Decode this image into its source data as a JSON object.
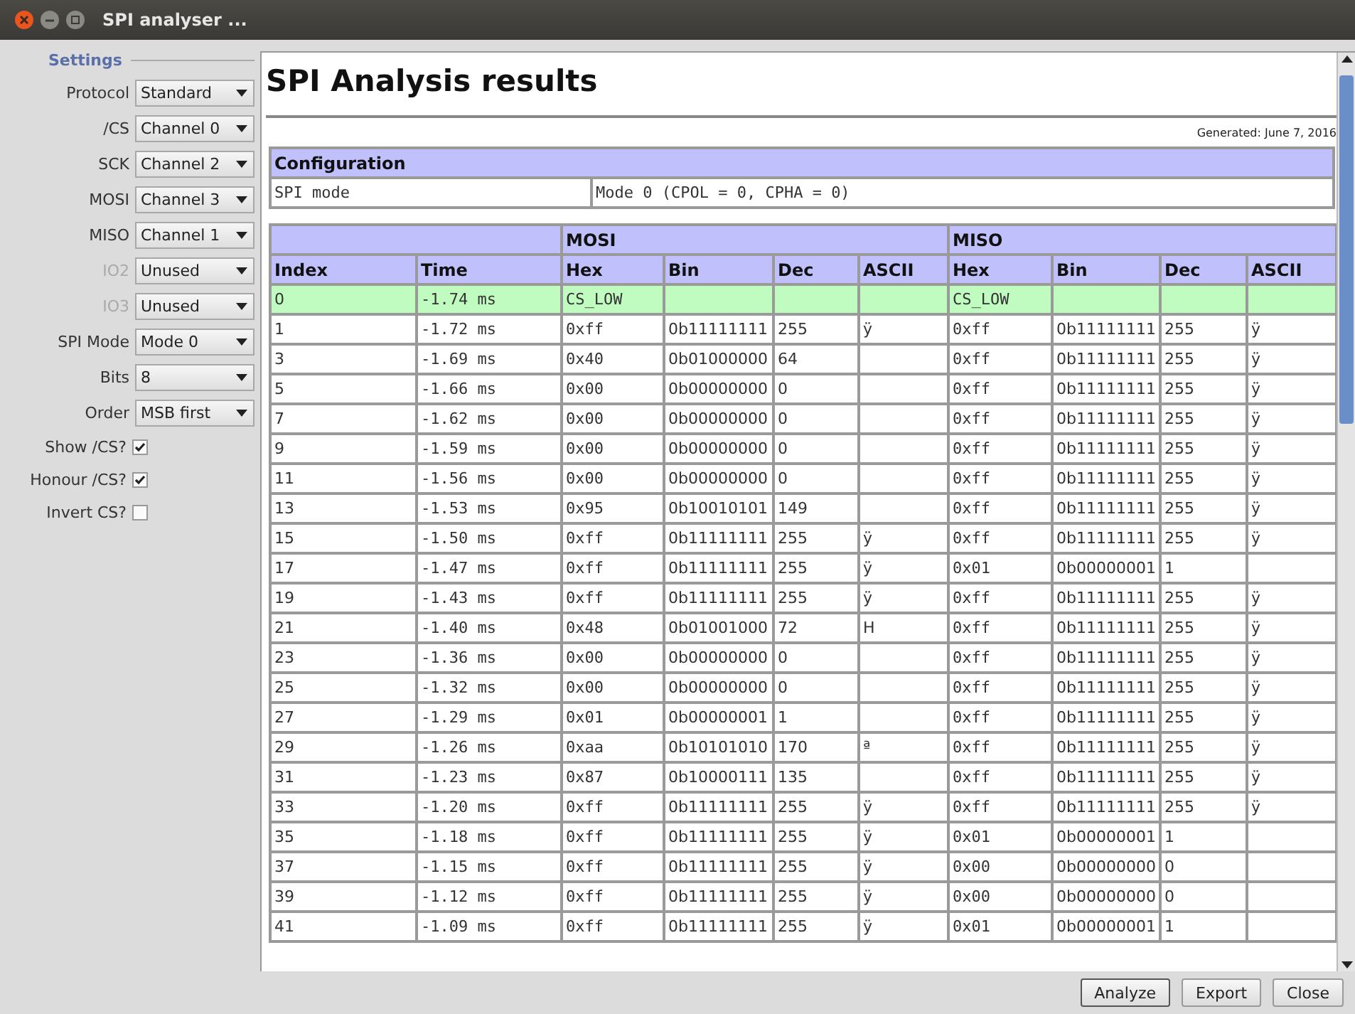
{
  "window": {
    "title": "SPI analyser ..."
  },
  "settings": {
    "title": "Settings",
    "items": [
      {
        "kind": "select",
        "label": "Protocol",
        "value": "Standard",
        "disabled": false
      },
      {
        "kind": "select",
        "label": "/CS",
        "value": "Channel 0",
        "disabled": false
      },
      {
        "kind": "select",
        "label": "SCK",
        "value": "Channel 2",
        "disabled": false
      },
      {
        "kind": "select",
        "label": "MOSI",
        "value": "Channel 3",
        "disabled": false
      },
      {
        "kind": "select",
        "label": "MISO",
        "value": "Channel 1",
        "disabled": false
      },
      {
        "kind": "select",
        "label": "IO2",
        "value": "Unused",
        "disabled": true
      },
      {
        "kind": "select",
        "label": "IO3",
        "value": "Unused",
        "disabled": true
      },
      {
        "kind": "select",
        "label": "SPI Mode",
        "value": "Mode 0",
        "disabled": false
      },
      {
        "kind": "select",
        "label": "Bits",
        "value": "8",
        "disabled": false
      },
      {
        "kind": "select",
        "label": "Order",
        "value": "MSB first",
        "disabled": false
      },
      {
        "kind": "checkbox",
        "label": "Show /CS?",
        "checked": true
      },
      {
        "kind": "checkbox",
        "label": "Honour /CS?",
        "checked": true
      },
      {
        "kind": "checkbox",
        "label": "Invert CS?",
        "checked": false
      }
    ]
  },
  "report": {
    "title": "SPI Analysis results",
    "generated": "Generated: June 7, 2016",
    "configuration": {
      "title": "Configuration",
      "rows": [
        [
          "SPI mode",
          "Mode 0 (CPOL = 0, CPHA = 0)"
        ]
      ]
    },
    "table": {
      "groups": [
        "MOSI",
        "MISO"
      ],
      "columns": [
        "Index",
        "Time",
        "Hex",
        "Bin",
        "Dec",
        "ASCII",
        "Hex",
        "Bin",
        "Dec",
        "ASCII"
      ],
      "rows": [
        {
          "highlighted": true,
          "cells": [
            "0",
            "-1.74 ms",
            "CS_LOW",
            "",
            "",
            "",
            "CS_LOW",
            "",
            "",
            ""
          ]
        },
        {
          "highlighted": false,
          "cells": [
            "1",
            "-1.72 ms",
            "0xff",
            "0b11111111",
            "255",
            "ÿ",
            "0xff",
            "0b11111111",
            "255",
            "ÿ"
          ]
        },
        {
          "highlighted": false,
          "cells": [
            "3",
            "-1.69 ms",
            "0x40",
            "0b01000000",
            "64",
            "",
            "0xff",
            "0b11111111",
            "255",
            "ÿ"
          ]
        },
        {
          "highlighted": false,
          "cells": [
            "5",
            "-1.66 ms",
            "0x00",
            "0b00000000",
            "0",
            "",
            "0xff",
            "0b11111111",
            "255",
            "ÿ"
          ]
        },
        {
          "highlighted": false,
          "cells": [
            "7",
            "-1.62 ms",
            "0x00",
            "0b00000000",
            "0",
            "",
            "0xff",
            "0b11111111",
            "255",
            "ÿ"
          ]
        },
        {
          "highlighted": false,
          "cells": [
            "9",
            "-1.59 ms",
            "0x00",
            "0b00000000",
            "0",
            "",
            "0xff",
            "0b11111111",
            "255",
            "ÿ"
          ]
        },
        {
          "highlighted": false,
          "cells": [
            "11",
            "-1.56 ms",
            "0x00",
            "0b00000000",
            "0",
            "",
            "0xff",
            "0b11111111",
            "255",
            "ÿ"
          ]
        },
        {
          "highlighted": false,
          "cells": [
            "13",
            "-1.53 ms",
            "0x95",
            "0b10010101",
            "149",
            "",
            "0xff",
            "0b11111111",
            "255",
            "ÿ"
          ]
        },
        {
          "highlighted": false,
          "cells": [
            "15",
            "-1.50 ms",
            "0xff",
            "0b11111111",
            "255",
            "ÿ",
            "0xff",
            "0b11111111",
            "255",
            "ÿ"
          ]
        },
        {
          "highlighted": false,
          "cells": [
            "17",
            "-1.47 ms",
            "0xff",
            "0b11111111",
            "255",
            "ÿ",
            "0x01",
            "0b00000001",
            "1",
            ""
          ]
        },
        {
          "highlighted": false,
          "cells": [
            "19",
            "-1.43 ms",
            "0xff",
            "0b11111111",
            "255",
            "ÿ",
            "0xff",
            "0b11111111",
            "255",
            "ÿ"
          ]
        },
        {
          "highlighted": false,
          "cells": [
            "21",
            "-1.40 ms",
            "0x48",
            "0b01001000",
            "72",
            "H",
            "0xff",
            "0b11111111",
            "255",
            "ÿ"
          ]
        },
        {
          "highlighted": false,
          "cells": [
            "23",
            "-1.36 ms",
            "0x00",
            "0b00000000",
            "0",
            "",
            "0xff",
            "0b11111111",
            "255",
            "ÿ"
          ]
        },
        {
          "highlighted": false,
          "cells": [
            "25",
            "-1.32 ms",
            "0x00",
            "0b00000000",
            "0",
            "",
            "0xff",
            "0b11111111",
            "255",
            "ÿ"
          ]
        },
        {
          "highlighted": false,
          "cells": [
            "27",
            "-1.29 ms",
            "0x01",
            "0b00000001",
            "1",
            "",
            "0xff",
            "0b11111111",
            "255",
            "ÿ"
          ]
        },
        {
          "highlighted": false,
          "cells": [
            "29",
            "-1.26 ms",
            "0xaa",
            "0b10101010",
            "170",
            "ª",
            "0xff",
            "0b11111111",
            "255",
            "ÿ"
          ]
        },
        {
          "highlighted": false,
          "cells": [
            "31",
            "-1.23 ms",
            "0x87",
            "0b10000111",
            "135",
            "",
            "0xff",
            "0b11111111",
            "255",
            "ÿ"
          ]
        },
        {
          "highlighted": false,
          "cells": [
            "33",
            "-1.20 ms",
            "0xff",
            "0b11111111",
            "255",
            "ÿ",
            "0xff",
            "0b11111111",
            "255",
            "ÿ"
          ]
        },
        {
          "highlighted": false,
          "cells": [
            "35",
            "-1.18 ms",
            "0xff",
            "0b11111111",
            "255",
            "ÿ",
            "0x01",
            "0b00000001",
            "1",
            ""
          ]
        },
        {
          "highlighted": false,
          "cells": [
            "37",
            "-1.15 ms",
            "0xff",
            "0b11111111",
            "255",
            "ÿ",
            "0x00",
            "0b00000000",
            "0",
            ""
          ]
        },
        {
          "highlighted": false,
          "cells": [
            "39",
            "-1.12 ms",
            "0xff",
            "0b11111111",
            "255",
            "ÿ",
            "0x00",
            "0b00000000",
            "0",
            ""
          ]
        },
        {
          "highlighted": false,
          "cells": [
            "41",
            "-1.09 ms",
            "0xff",
            "0b11111111",
            "255",
            "ÿ",
            "0x01",
            "0b00000001",
            "1",
            ""
          ]
        }
      ]
    }
  },
  "buttons": [
    "Analyze",
    "Export",
    "Close"
  ]
}
